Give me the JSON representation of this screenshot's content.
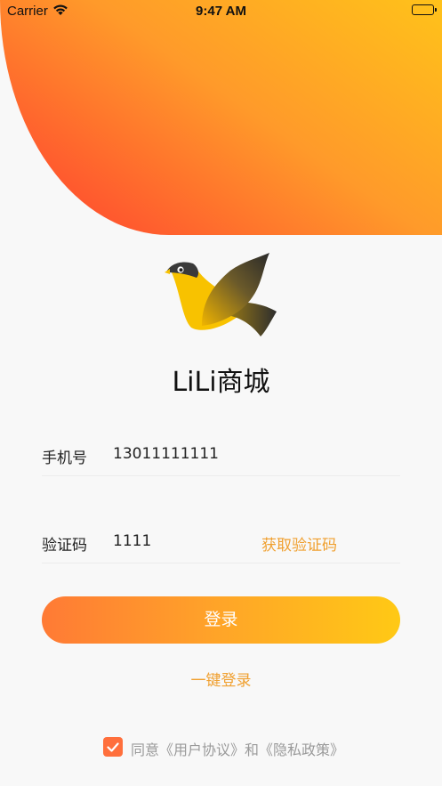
{
  "status_bar": {
    "carrier": "Carrier",
    "time": "9:47 AM"
  },
  "app": {
    "title": "LiLi商城"
  },
  "form": {
    "phone": {
      "label": "手机号",
      "value": "13011111111"
    },
    "code": {
      "label": "验证码",
      "value": "1111",
      "get_code_label": "获取验证码"
    }
  },
  "actions": {
    "login_label": "登录",
    "one_click_label": "一键登录"
  },
  "agreement": {
    "checked": true,
    "text": "同意《用户协议》和《隐私政策》"
  },
  "colors": {
    "accent": "#f0a030",
    "gradient_start": "#ff7a35",
    "gradient_end": "#ffc915",
    "checkbox": "#ff6f3c"
  }
}
